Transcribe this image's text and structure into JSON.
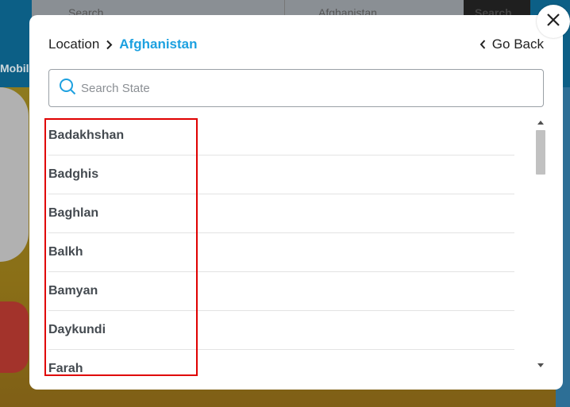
{
  "background": {
    "search_ghost": "Search",
    "location_ghost": "Afghanistan",
    "button_ghost": "Search",
    "nav_label": "Mobile"
  },
  "modal": {
    "breadcrumb": {
      "root": "Location",
      "current": "Afghanistan"
    },
    "go_back_label": "Go Back",
    "search": {
      "placeholder": "Search State",
      "value": ""
    },
    "states": [
      "Badakhshan",
      "Badghis",
      "Baghlan",
      "Balkh",
      "Bamyan",
      "Daykundi",
      "Farah"
    ]
  },
  "colors": {
    "accent": "#1da1e0",
    "highlight": "#e00000"
  }
}
